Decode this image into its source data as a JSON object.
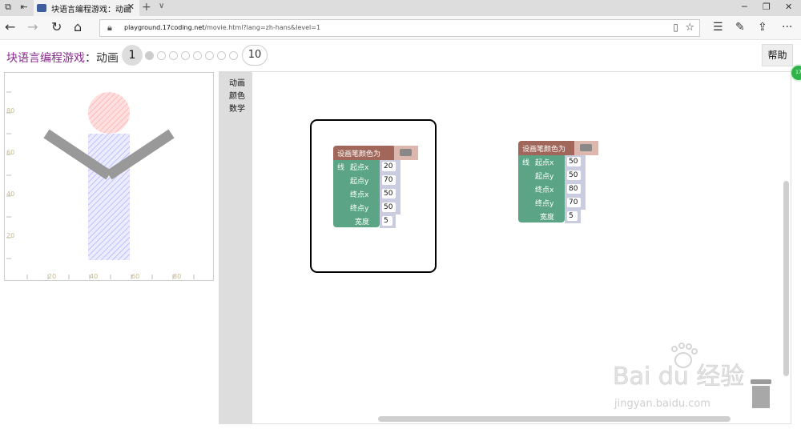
{
  "browser": {
    "tab_title": "块语言编程游戏：动画",
    "url_host": "playground.17coding.net",
    "url_path": "/movie.html?lang=zh-hans&level=1"
  },
  "header": {
    "app_name": "块语言编程游戏",
    "separator": "：",
    "page_name": "动画",
    "current_level": "1",
    "last_level": "10",
    "help_label": "帮助",
    "badge_text": "17"
  },
  "preview": {
    "axis_x_ticks": [
      "20",
      "40",
      "60",
      "80"
    ],
    "axis_y_ticks": [
      "80",
      "60",
      "40",
      "20"
    ]
  },
  "toolbox": {
    "categories": [
      "动画",
      "颜色",
      "数学"
    ]
  },
  "blocks": [
    {
      "pen_label": "设画笔颜色为",
      "line_label": "线",
      "x1_label": "起点x",
      "x1": "20",
      "y1_label": "起点y",
      "y1": "70",
      "x2_label": "终点x",
      "x2": "50",
      "y2_label": "终点y",
      "y2": "50",
      "width_label": "宽度",
      "width": "5"
    },
    {
      "pen_label": "设画笔颜色为",
      "line_label": "线",
      "x1_label": "起点x",
      "x1": "50",
      "y1_label": "起点y",
      "y1": "50",
      "x2_label": "终点x",
      "x2": "80",
      "y2_label": "终点y",
      "y2": "70",
      "width_label": "宽度",
      "width": "5"
    }
  ],
  "watermark": {
    "brand": "Bai du 经验",
    "site": "jingyan.baidu.com"
  },
  "colors": {
    "accent": "#8a2a90",
    "pen_block": "#a0675a",
    "line_block": "#5ba586",
    "head": "#ffb3b3",
    "body": "#b3b3ff",
    "arms": "#999999"
  }
}
